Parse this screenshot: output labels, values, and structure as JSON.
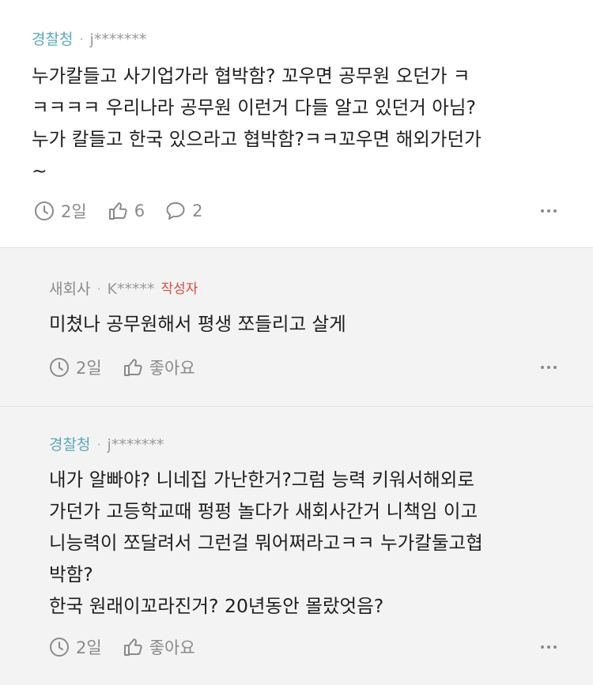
{
  "comments": [
    {
      "author": "경찰청",
      "user_id": "j*******",
      "text": "누가칼들고 사기업가라 협박함? 꼬우면 공무원 오던가 ㅋ\nㅋㅋㅋㅋ 우리나라 공무원 이런거 다들 알고 있던거 아님?\n누가 칼들고 한국 있으라고 협박함?ㅋㅋ꼬우면 해외가던가\n~",
      "time": "2일",
      "likes": "6",
      "replies": "2"
    },
    {
      "author": "새회사",
      "user_id": "K*****",
      "badge": "작성자",
      "text": "미쳤나 공무원해서 평생 쪼들리고 살게",
      "time": "2일",
      "like_label": "좋아요"
    },
    {
      "author": "경찰청",
      "user_id": "j*******",
      "text": "내가 알빠야? 니네집 가난한거?그럼 능력 키워서해외로\n가던가 고등학교때 펑펑 놀다가 새회사간거 니책임 이고\n니능력이 쪼달려서 그런걸 뭐어쩌라고ㅋㅋ 누가칼둘고협\n박함?\n한국 원래이꼬라진거? 20년동안 몰랐엇음?",
      "time": "2일",
      "like_label": "좋아요"
    }
  ],
  "separator": "·",
  "icons": {
    "clock": "clock-icon",
    "thumb": "thumbs-up-icon",
    "comment": "comment-bubble-icon",
    "more": "more-options-icon"
  },
  "colors": {
    "author_teal": "#5aa9b9",
    "badge_red": "#e04a3c",
    "reply_bg": "#f3f3f3"
  }
}
